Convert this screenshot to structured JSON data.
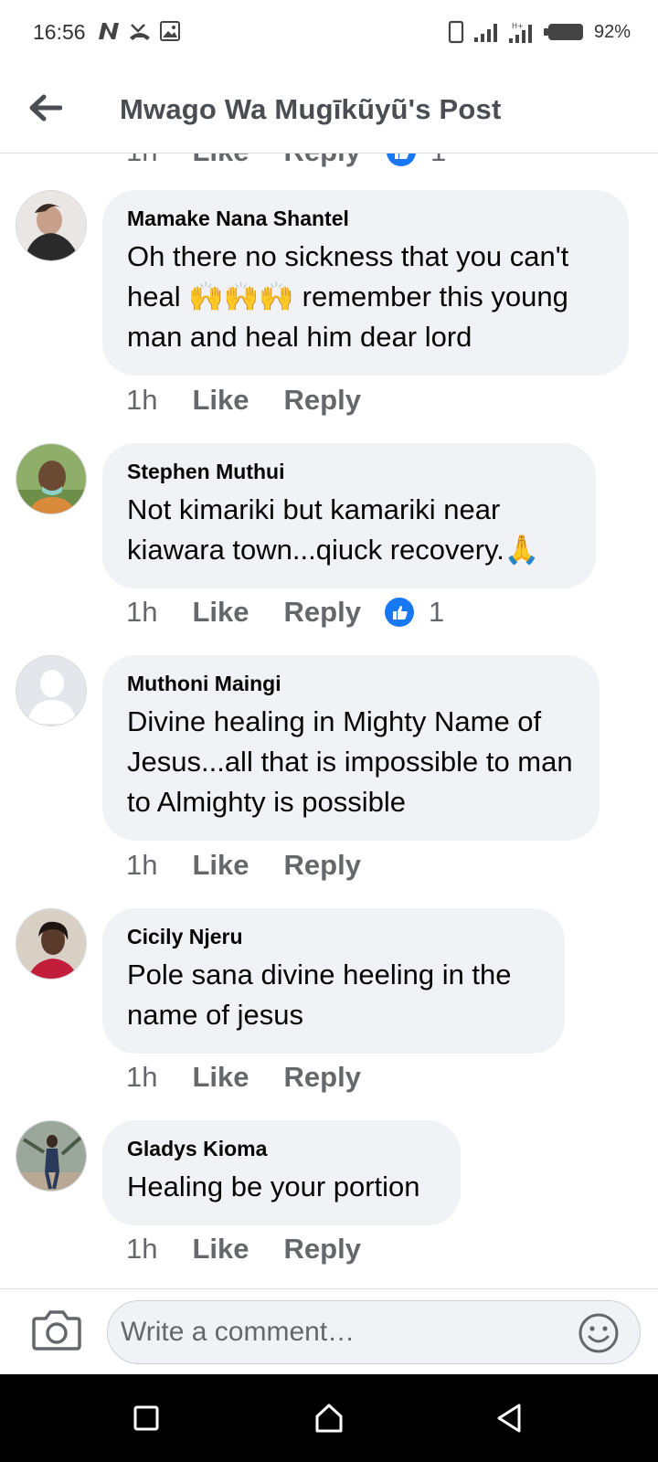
{
  "status_bar": {
    "time": "16:56",
    "battery": "92%"
  },
  "header": {
    "title": "Mwago Wa Mugīkũyũ's Post"
  },
  "partial_meta": {
    "time": "1h",
    "like": "Like",
    "reply": "Reply",
    "reaction_count": "1"
  },
  "comments": [
    {
      "author": "Mamake Nana Shantel",
      "text": "Oh there no sickness that you can't heal 🙌🙌🙌 remember this young man and heal him dear lord",
      "time": "1h",
      "like_label": "Like",
      "reply_label": "Reply",
      "reaction_count": null
    },
    {
      "author": "Stephen Muthui",
      "text": "Not kimariki but kamariki near kiawara town...qiuck recovery.🙏",
      "time": "1h",
      "like_label": "Like",
      "reply_label": "Reply",
      "reaction_count": "1"
    },
    {
      "author": "Muthoni Maingi",
      "text": "Divine healing in Mighty Name of Jesus...all that is impossible to man to Almighty is possible",
      "time": "1h",
      "like_label": "Like",
      "reply_label": "Reply",
      "reaction_count": null
    },
    {
      "author": "Cicily Njeru",
      "text": "Pole sana divine heeling in the name of jesus",
      "time": "1h",
      "like_label": "Like",
      "reply_label": "Reply",
      "reaction_count": null
    },
    {
      "author": "Gladys Kioma",
      "text": "Healing be your portion",
      "time": "1h",
      "like_label": "Like",
      "reply_label": "Reply",
      "reaction_count": null
    }
  ],
  "composer": {
    "placeholder": "Write a comment…"
  },
  "icons": {
    "back": "arrow-left-icon",
    "camera": "camera-icon",
    "emoji": "smiley-icon",
    "like_reaction": "thumbs-up-icon",
    "nav_recents": "square-icon",
    "nav_home": "home-icon",
    "nav_back": "triangle-back-icon"
  },
  "colors": {
    "accent": "#1877f2",
    "bubble": "#f0f2f5",
    "meta_text": "#65676b",
    "title_text": "#4a4d52"
  }
}
